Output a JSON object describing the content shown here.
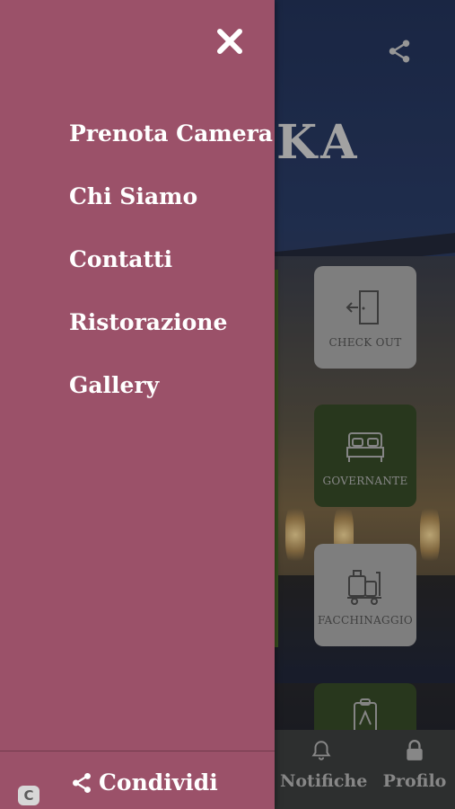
{
  "background": {
    "brand_fragment": "KA",
    "tiles": [
      {
        "label": "CHECK OUT",
        "icon": "door-exit-icon",
        "variant": "light"
      },
      {
        "label": "GOVERNANTE",
        "icon": "bed-icon",
        "variant": "green"
      },
      {
        "label": "FACCHINAGGIO",
        "icon": "luggage-cart-icon",
        "variant": "light"
      },
      {
        "label": "",
        "icon": "badge-icon",
        "variant": "green"
      }
    ],
    "bottom_tabs": [
      {
        "label": "Notifiche",
        "icon": "bell-icon"
      },
      {
        "label": "Profilo",
        "icon": "lock-icon"
      }
    ]
  },
  "drawer": {
    "menu": [
      {
        "label": "Prenota Camera"
      },
      {
        "label": "Chi Siamo"
      },
      {
        "label": "Contatti"
      },
      {
        "label": "Ristorazione"
      },
      {
        "label": "Gallery"
      }
    ],
    "share_label": "Condividi",
    "badge_letter": "C"
  },
  "colors": {
    "drawer_bg": "#9b5169",
    "tile_green": "#364a27",
    "tile_light": "#a9a9a9"
  }
}
